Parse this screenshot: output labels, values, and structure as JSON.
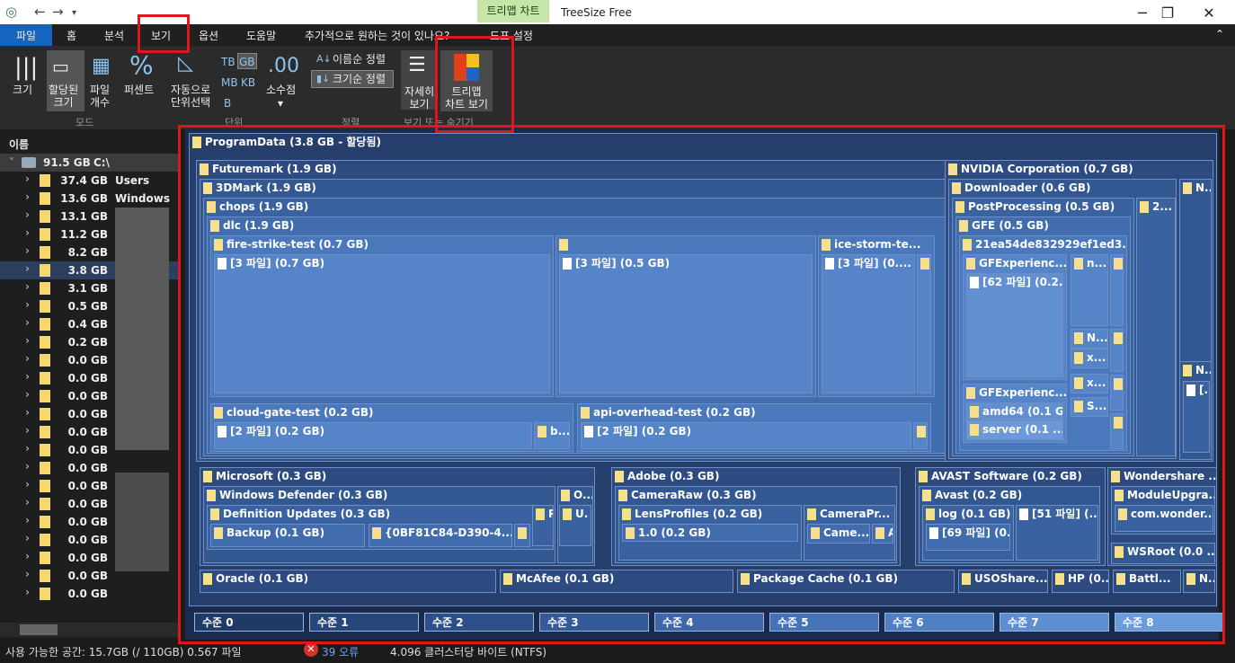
{
  "titlebar": {
    "ctx_tab": "트리맵 차트",
    "app_title": "TreeSize Free"
  },
  "menu": [
    "파일",
    "홈",
    "분석",
    "보기",
    "옵션",
    "도움말",
    "추가적으로 원하는 것이 있나요?",
    "도표 설정"
  ],
  "ribbon": {
    "size": "크기",
    "alloc": "할당된\n크기",
    "filecount": "파일\n개수",
    "percent": "퍼센트",
    "auto_unit": "자동으로\n단위선택",
    "tb": "TB",
    "gb": "GB",
    "mb": "MB",
    "kb": "KB",
    "b": "B",
    "decimal_glyph": ".00",
    "decimal": "소수점",
    "sort_name": "이름순 정렬",
    "sort_size": "크기순 정렬",
    "detail": "자세히\n보기",
    "treemap": "트리맵\n차트 보기",
    "grp_mode": "모드",
    "grp_unit": "단위",
    "grp_sort": "정렬",
    "grp_view": "보기 또는 숨기기"
  },
  "tree": {
    "header": "이름",
    "root_size": "91.5 GB",
    "root_name": "C:\\",
    "rows": [
      {
        "size": "37.4 GB",
        "name": "Users"
      },
      {
        "size": "13.6 GB",
        "name": "Windows"
      },
      {
        "size": "13.1 GB",
        "name": ""
      },
      {
        "size": "11.2 GB",
        "name": ""
      },
      {
        "size": "8.2 GB",
        "name": ""
      },
      {
        "size": "3.8 GB",
        "name": ""
      },
      {
        "size": "3.1 GB",
        "name": ""
      },
      {
        "size": "0.5 GB",
        "name": ""
      },
      {
        "size": "0.4 GB",
        "name": ""
      },
      {
        "size": "0.2 GB",
        "name": ""
      },
      {
        "size": "0.0 GB",
        "name": ""
      },
      {
        "size": "0.0 GB",
        "name": ""
      },
      {
        "size": "0.0 GB",
        "name": ""
      },
      {
        "size": "0.0 GB",
        "name": ""
      },
      {
        "size": "0.0 GB",
        "name": ""
      },
      {
        "size": "0.0 GB",
        "name": ""
      },
      {
        "size": "0.0 GB",
        "name": ""
      },
      {
        "size": "0.0 GB",
        "name": ""
      },
      {
        "size": "0.0 GB",
        "name": ""
      },
      {
        "size": "0.0 GB",
        "name": ""
      },
      {
        "size": "0.0 GB",
        "name": ""
      },
      {
        "size": "0.0 GB",
        "name": ""
      },
      {
        "size": "0.0 GB",
        "name": ""
      },
      {
        "size": "0.0 GB",
        "name": ""
      }
    ]
  },
  "status": {
    "free": "사용 가능한 공간: 15.7GB (/ 110GB) 0.567 파일",
    "errors": "39 오류",
    "cluster": "4.096 클러스터당 바이트 (NTFS)"
  },
  "treemap": {
    "root": "ProgramData (3.8 GB - 할당됨)",
    "futuremark": "Futuremark (1.9 GB)",
    "threedmark": "3DMark (1.9 GB)",
    "chops": "chops (1.9 GB)",
    "dlc": "dlc (1.9 GB)",
    "firestrike": "fire-strike-test (0.7 GB)",
    "fs_files": "[3 파일] (0.7 GB)",
    "mid_files": "[3 파일] (0.5 GB)",
    "icestorm": "ice-storm-te...",
    "ice_files": "[3 파일] (0....",
    "ice_b": "b",
    "cloudgate": "cloud-gate-test (0.2 GB)",
    "cg_files": "[2 파일] (0.2 GB)",
    "cg_b": "b...",
    "apioverhead": "api-overhead-test (0.2 GB)",
    "api_files": "[2 파일] (0.2 GB)",
    "api_b": "b.",
    "nvidia": "NVIDIA Corporation (0.7 GB)",
    "downloader": "Downloader (0.6 GB)",
    "postproc": "PostProcessing (0.5 GB)",
    "two": "2...",
    "gfe": "GFE (0.5 GB)",
    "hash": "21ea54de832929ef1ed3...",
    "gfexp1": "GFExperienc...",
    "n_dot": "n...",
    "f62": "[62 파일] (0.2...",
    "gfexp2": "GFExperienc...",
    "amd64": "amd64 (0.1 G...",
    "server": "server (0.1 ...",
    "N": "N",
    "Ndot": "N...",
    "Bracket": "[...",
    "x": "x...",
    "S": "S...",
    "microsoft": "Microsoft (0.3 GB)",
    "windef": "Windows Defender (0.3 GB)",
    "o": "O...",
    "defupd": "Definition Updates (0.3 GB)",
    "p": "P.",
    "u": "U.",
    "backup": "Backup (0.1 GB)",
    "guid": "{0BF81C84-D390-4...",
    "s": "S.",
    "adobe": "Adobe (0.3 GB)",
    "cameraraw": "CameraRaw (0.3 GB)",
    "lensprof": "LensProfiles (0.2 GB)",
    "campr": "CameraPr...",
    "onezero": "1.0 (0.2 GB)",
    "came": "Came...",
    "a": "A.",
    "avast": "AVAST Software (0.2 GB)",
    "avast2": "Avast (0.2 GB)",
    "log": "log (0.1 GB)",
    "f51": "[51 파일] (...",
    "f69": "[69 파일] (0....",
    "wondershare": "Wondershare ...",
    "moduleup": "ModuleUpgra...",
    "comwonder": "com.wonder...",
    "wsroot": "WSRoot (0.0 ...",
    "oracle": "Oracle (0.1 GB)",
    "mcafee": "McAfee (0.1 GB)",
    "pkgcache": "Package Cache (0.1 GB)",
    "usoshare": "USOShare...",
    "hp": "HP (0....",
    "battle": "Battl...",
    "nlast": "N..."
  },
  "levels": [
    "수준 0",
    "수준 1",
    "수준 2",
    "수준 3",
    "수준 4",
    "수준 5",
    "수준 6",
    "수준 7",
    "수준 8"
  ]
}
